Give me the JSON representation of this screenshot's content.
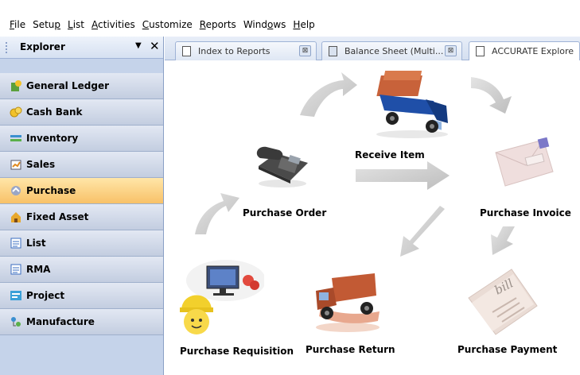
{
  "menubar": {
    "items": [
      {
        "underline": "F",
        "rest": "ile"
      },
      {
        "pre": "Setu",
        "underline": "p",
        "rest": ""
      },
      {
        "underline": "L",
        "rest": "ist"
      },
      {
        "underline": "A",
        "rest": "ctivities"
      },
      {
        "underline": "C",
        "rest": "ustomize"
      },
      {
        "underline": "R",
        "rest": "eports"
      },
      {
        "pre": "Wind",
        "underline": "o",
        "rest": "ws"
      },
      {
        "underline": "H",
        "rest": "elp"
      }
    ]
  },
  "explorer": {
    "title": "Explorer",
    "pin_glyph": "▼",
    "close_glyph": "✕",
    "items": [
      {
        "label": "General Ledger",
        "icon": "general-ledger-icon"
      },
      {
        "label": "Cash Bank",
        "icon": "cash-bank-icon"
      },
      {
        "label": "Inventory",
        "icon": "inventory-icon"
      },
      {
        "label": "Sales",
        "icon": "sales-icon"
      },
      {
        "label": "Purchase",
        "icon": "purchase-icon",
        "selected": true
      },
      {
        "label": "Fixed Asset",
        "icon": "fixed-asset-icon"
      },
      {
        "label": "List",
        "icon": "list-icon"
      },
      {
        "label": "RMA",
        "icon": "rma-icon"
      },
      {
        "label": "Project",
        "icon": "project-icon"
      },
      {
        "label": "Manufacture",
        "icon": "manufacture-icon"
      }
    ]
  },
  "tabs": [
    {
      "label": "Index to Reports",
      "close": "⊠"
    },
    {
      "label": "Balance Sheet (Multi...",
      "close": "⊠"
    },
    {
      "label": "ACCURATE Explore",
      "active": true
    }
  ],
  "flow": {
    "purchase_order": "Purchase Order",
    "receive_item": "Receive Item",
    "purchase_invoice": "Purchase Invoice",
    "purchase_requisition": "Purchase Requisition",
    "purchase_return": "Purchase Return",
    "purchase_payment": "Purchase Payment",
    "bill_text": "bill"
  },
  "colors": {
    "explorer_bg": "#c5d3ea",
    "selected_bg": "#f8c168",
    "arrow_gray": "#c8c8c8",
    "truck_blue": "#1f4fa8",
    "truck_red": "#b34a2a"
  }
}
